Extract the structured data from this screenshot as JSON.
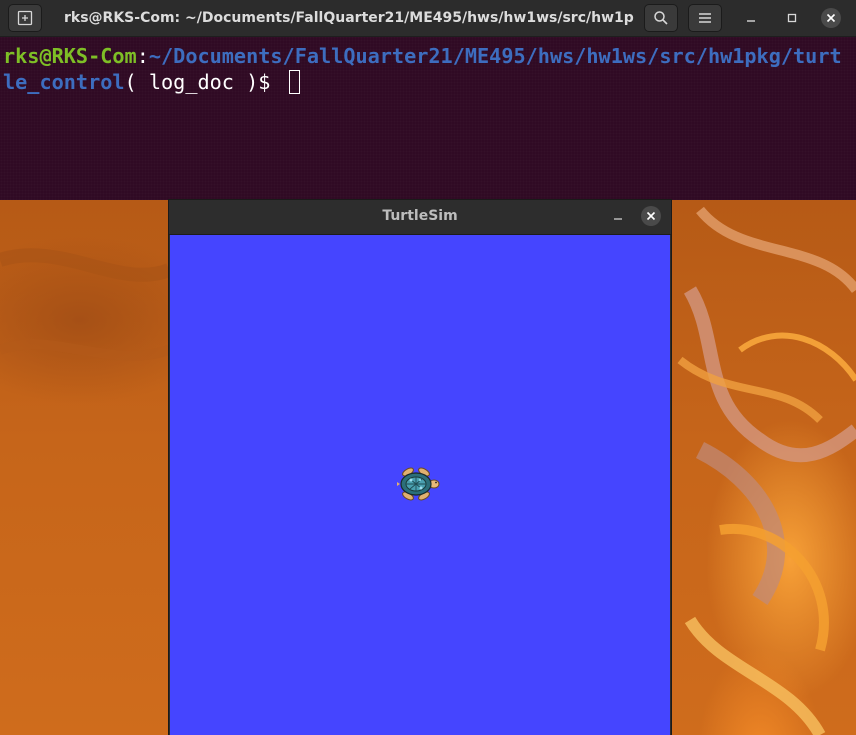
{
  "terminal": {
    "title": "rks@RKS-Com: ~/Documents/FallQuarter21/ME495/hws/hw1ws/src/hw1pkg/t...",
    "prompt_user": "rks@RKS-Com",
    "prompt_colon": ":",
    "prompt_path": "~/Documents/FallQuarter21/ME495/hws/hw1ws/src/hw1pkg/turtle_control",
    "command_suffix": "( log_doc )$ ",
    "icons": {
      "new_tab": "new-tab-icon",
      "search": "search-icon",
      "menu": "hamburger-menu-icon",
      "minimize": "minimize-icon",
      "maximize": "maximize-icon",
      "close": "close-icon"
    },
    "colors": {
      "background": "#300a24",
      "user": "#7ebf26",
      "path": "#3d6dbf",
      "text": "#ffffff"
    }
  },
  "turtlesim": {
    "title": "TurtleSim",
    "canvas_color": "#4545ff",
    "icons": {
      "minimize": "minimize-icon",
      "close": "close-icon",
      "turtle": "turtle-icon"
    }
  },
  "desktop": {
    "wallpaper_color": "#c25f15"
  }
}
